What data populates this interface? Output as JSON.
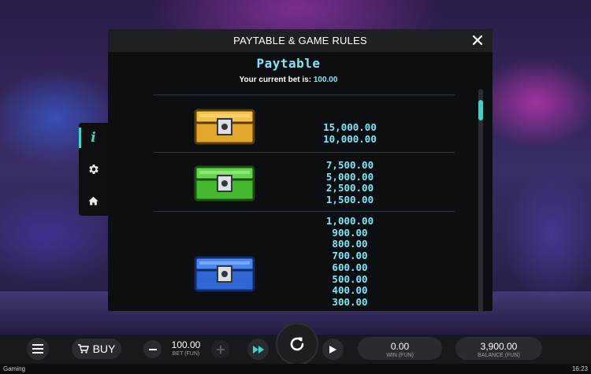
{
  "modal": {
    "title": "PAYTABLE & GAME RULES",
    "section_title": "Paytable",
    "bet_label": "Your current bet is:",
    "bet_value": "100.00"
  },
  "paytable": [
    {
      "chest": "gold-chest",
      "color": "#e2a62a",
      "payouts": [
        "15,000.00",
        "10,000.00"
      ]
    },
    {
      "chest": "green-chest",
      "color": "#4fcf3a",
      "payouts": [
        "7,500.00",
        "5,000.00",
        "2,500.00",
        "1,500.00"
      ]
    },
    {
      "chest": "blue-chest",
      "color": "#3f7be8",
      "payouts": [
        "1,000.00",
        "900.00",
        "800.00",
        "700.00",
        "600.00",
        "500.00",
        "400.00",
        "300.00"
      ]
    }
  ],
  "side_menu": {
    "items": [
      "info-icon",
      "gear-icon",
      "home-icon"
    ],
    "active": "info-icon"
  },
  "bottom": {
    "buy_label": "BUY",
    "bet_value": "100.00",
    "bet_label": "BET (FUN)",
    "win_value": "0.00",
    "win_label": "WIN (FUN)",
    "balance_value": "3,900.00",
    "balance_label": "BALANCE (FUN)"
  },
  "status": {
    "app_name": "Gaming",
    "time": "16:23"
  },
  "colors": {
    "accent": "#3fd3c8",
    "payout": "#7fe6f5"
  }
}
